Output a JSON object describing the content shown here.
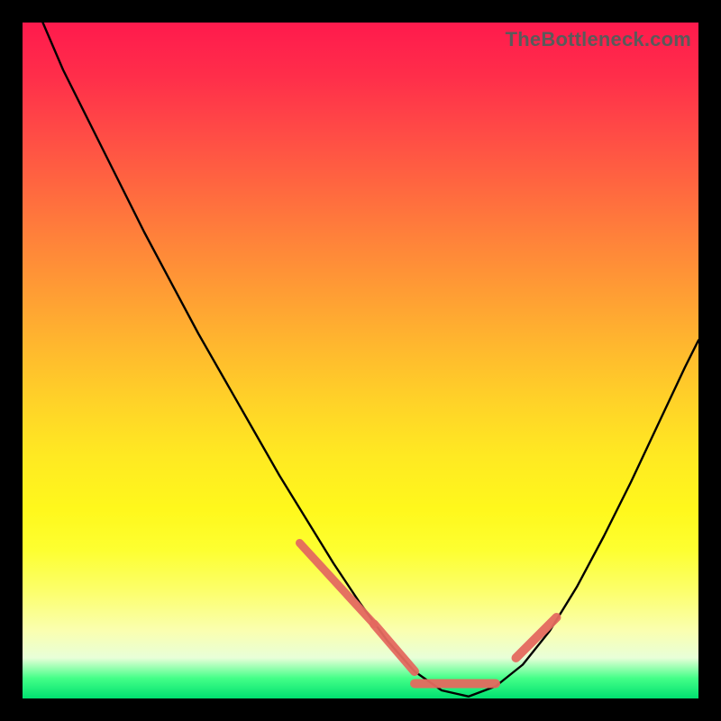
{
  "watermark": "TheBottleneck.com",
  "colors": {
    "curve": "#000000",
    "highlight": "#e4695f",
    "gradient_top": "#ff1a4d",
    "gradient_bottom": "#00e070"
  },
  "chart_data": {
    "type": "line",
    "title": "",
    "xlabel": "",
    "ylabel": "",
    "xlim": [
      0,
      100
    ],
    "ylim": [
      0,
      100
    ],
    "note": "Bottleneck-shaped curve on a red→green vertical gradient; lower y is better (green). Curve descends steeply from top-left, bottoms near x≈55–65, and rises toward the right. Short salmon marker segments mask parts of the curve near the trough. Values are visual estimates from pixel positions.",
    "series": [
      {
        "name": "bottleneck-curve",
        "x": [
          3,
          6,
          10,
          14,
          18,
          22,
          26,
          30,
          34,
          38,
          42,
          46,
          50,
          54,
          58,
          62,
          66,
          70,
          74,
          78,
          82,
          86,
          90,
          94,
          98,
          100
        ],
        "y": [
          100,
          93,
          85,
          77,
          69,
          61.5,
          54,
          47,
          40,
          33,
          26.5,
          20,
          14,
          8.5,
          4,
          1.2,
          0.3,
          1.8,
          5,
          10,
          16.5,
          24,
          32,
          40.5,
          49,
          53
        ]
      }
    ],
    "highlight_segments": [
      {
        "x": [
          41,
          52
        ],
        "y": [
          23,
          11
        ],
        "width": 9
      },
      {
        "x": [
          52,
          58
        ],
        "y": [
          11,
          4
        ],
        "width": 10
      },
      {
        "x": [
          58,
          70
        ],
        "y": [
          2.2,
          2.2
        ],
        "width": 10
      },
      {
        "x": [
          73,
          79
        ],
        "y": [
          6,
          12
        ],
        "width": 10
      }
    ]
  }
}
